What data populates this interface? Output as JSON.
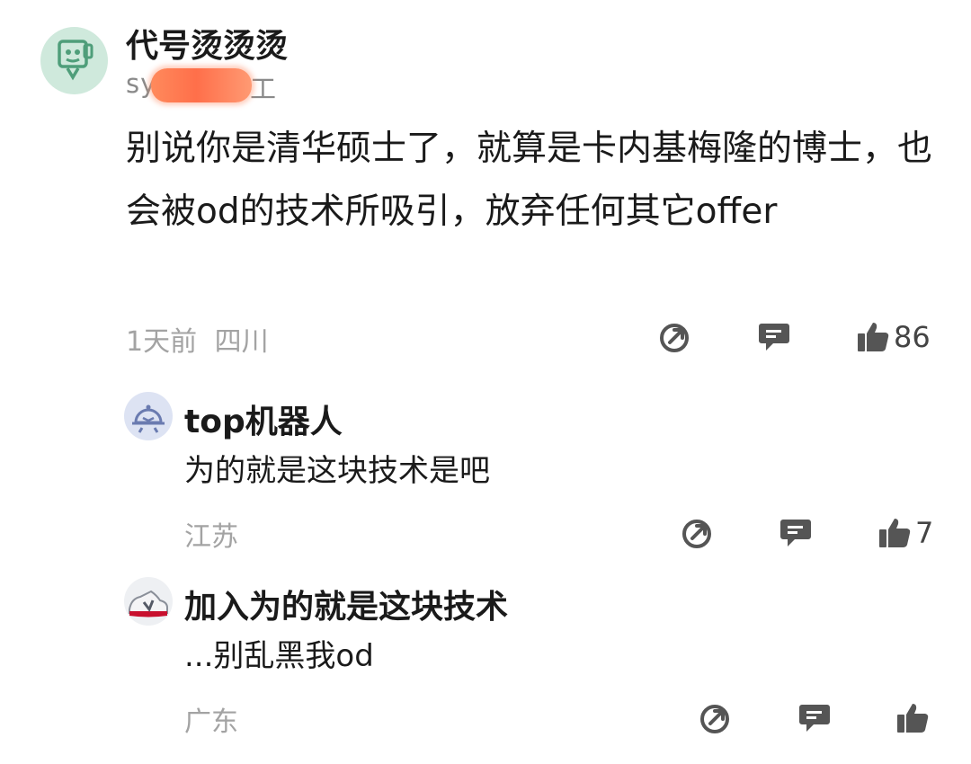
{
  "comment": {
    "username": "代号烫烫烫",
    "subtitle_prefix": "sy",
    "subtitle_suffix": "工",
    "text": "别说你是清华硕士了，就算是卡内基梅隆的博士，也会被od的技术所吸引，放弃任何其它offer",
    "time": "1天前",
    "location": "四川",
    "likes": "86"
  },
  "replies": [
    {
      "username": "top机器人",
      "text": "为的就是这块技术是吧",
      "location": "江苏",
      "likes": "7"
    },
    {
      "username": "加入为的就是这块技术",
      "text": "...别乱黑我od",
      "location": "广东",
      "likes": ""
    }
  ],
  "icons": {
    "share": "share-icon",
    "reply": "comment-bubble-icon",
    "like": "thumbs-up-icon"
  },
  "colors": {
    "redaction": "#ff7a50",
    "avatar_bg": "#cfe9dc",
    "meta_text": "#a3a3a3"
  }
}
